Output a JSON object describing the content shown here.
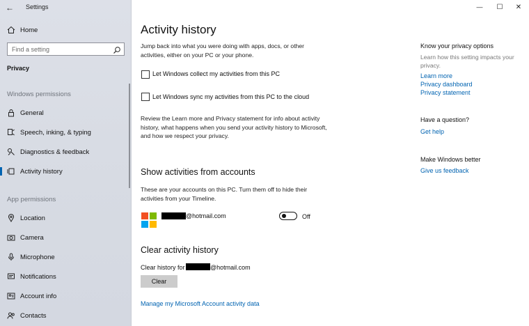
{
  "window": {
    "title": "Settings",
    "controls": {
      "minimize": "—",
      "maximize": "☐",
      "close": "✕"
    }
  },
  "sidebar": {
    "home": "Home",
    "search_placeholder": "Find a setting",
    "breadcrumb": "Privacy",
    "groups": {
      "windows_permissions": "Windows permissions",
      "app_permissions": "App permissions"
    },
    "windows_items": [
      {
        "label": "General",
        "icon": "lock-icon"
      },
      {
        "label": "Speech, inking, & typing",
        "icon": "speech-icon"
      },
      {
        "label": "Diagnostics & feedback",
        "icon": "diagnostics-icon"
      },
      {
        "label": "Activity history",
        "icon": "activity-icon",
        "active": true
      }
    ],
    "app_items": [
      {
        "label": "Location",
        "icon": "location-icon"
      },
      {
        "label": "Camera",
        "icon": "camera-icon"
      },
      {
        "label": "Microphone",
        "icon": "microphone-icon"
      },
      {
        "label": "Notifications",
        "icon": "notifications-icon"
      },
      {
        "label": "Account info",
        "icon": "account-icon"
      },
      {
        "label": "Contacts",
        "icon": "contacts-icon"
      }
    ]
  },
  "main": {
    "title": "Activity history",
    "intro": "Jump back into what you were doing with apps, docs, or other activities, either on your PC or your phone.",
    "checkbox_collect": "Let Windows collect my activities from this PC",
    "checkbox_sync": "Let Windows sync my activities from this PC to the cloud",
    "review_text": "Review the Learn more and Privacy statement for info about activity history, what happens when you send your activity history to Microsoft, and how we respect your privacy.",
    "accounts_heading": "Show activities from accounts",
    "accounts_text": "These are your accounts on this PC. Turn them off to hide their activities from your Timeline.",
    "account_email_suffix": "@hotmail.com",
    "toggle_state": "Off",
    "clear_heading": "Clear activity history",
    "clear_for_prefix": "Clear history for",
    "clear_email_suffix": "@hotmail.com",
    "clear_button": "Clear",
    "manage_link": "Manage my Microsoft Account activity data"
  },
  "right_panel": {
    "privacy_heading": "Know your privacy options",
    "privacy_text": "Learn how this setting impacts your privacy.",
    "links": [
      "Learn more",
      "Privacy dashboard",
      "Privacy statement"
    ],
    "question_heading": "Have a question?",
    "help_link": "Get help",
    "better_heading": "Make Windows better",
    "feedback_link": "Give us feedback"
  },
  "colors": {
    "accent": "#0063b1",
    "ms_red": "#f25022",
    "ms_green": "#7fba00",
    "ms_blue": "#00a4ef",
    "ms_yellow": "#ffb900"
  }
}
